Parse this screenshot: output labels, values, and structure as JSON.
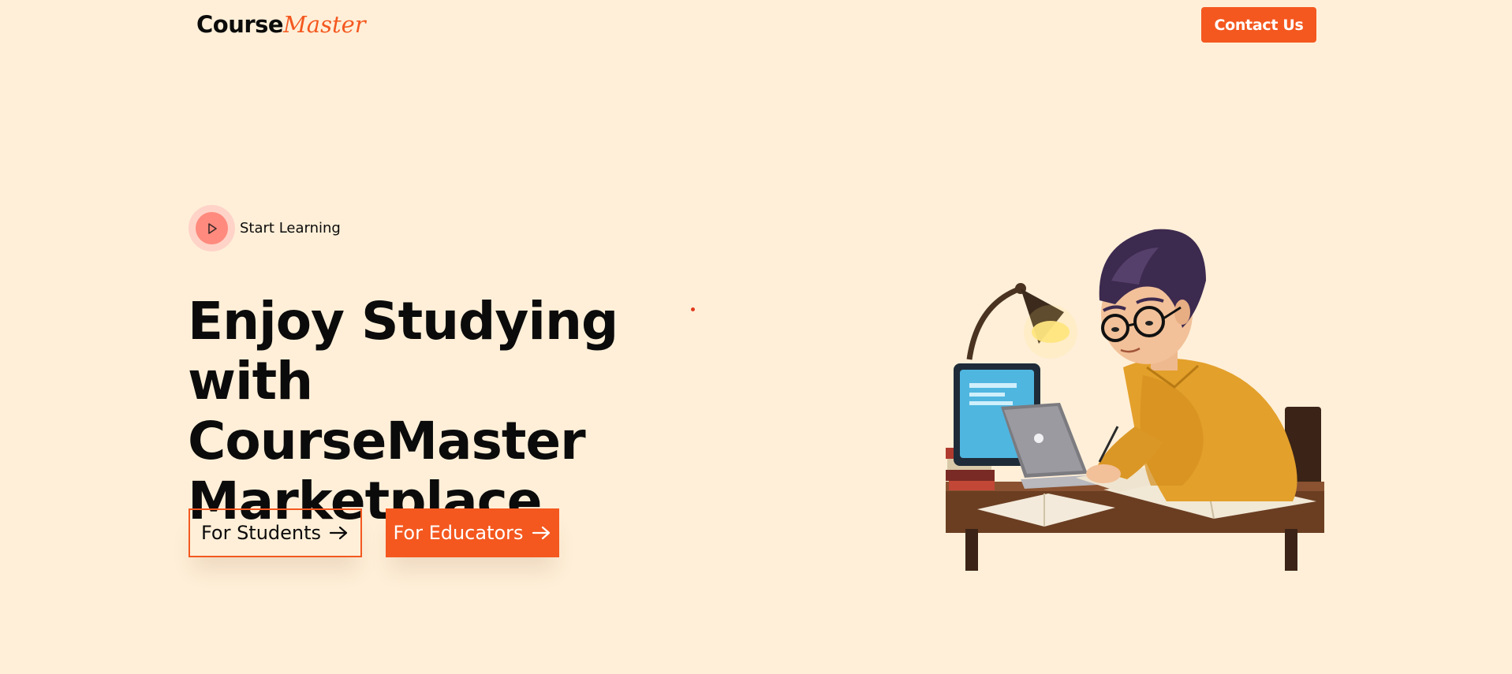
{
  "header": {
    "logo_primary": "Course",
    "logo_accent": "Master",
    "contact_label": "Contact Us"
  },
  "hero": {
    "start_label": "Start Learning",
    "headline_line1": "Enjoy Studying with",
    "headline_line2": "CourseMaster",
    "headline_line3": "Marketplace",
    "students_label": "For Students",
    "educators_label": "For Educators"
  },
  "colors": {
    "background": "#FFEFD8",
    "accent": "#F4581F",
    "play_ring": "#FFD3C8",
    "play_fill": "#FF8A7D",
    "text": "#0b0b0b"
  },
  "icons": {
    "play": "play-icon",
    "arrow": "arrow-right-icon",
    "illustration": "student-studying-illustration"
  }
}
